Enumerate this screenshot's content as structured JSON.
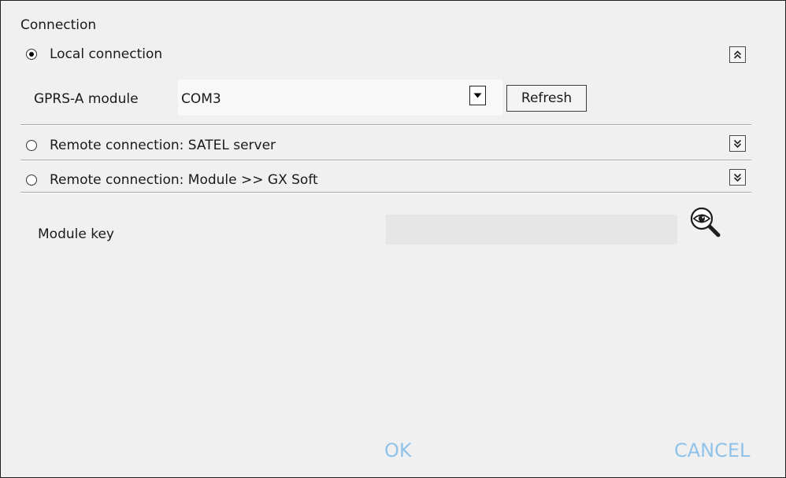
{
  "section_title": "Connection",
  "local": {
    "label": "Local connection",
    "selected": true,
    "module_label": "GPRS-A module",
    "port_value": "COM3",
    "refresh_label": "Refresh"
  },
  "remote_satel": {
    "label": "Remote connection: SATEL server",
    "selected": false
  },
  "remote_module": {
    "label": "Remote connection: Module >> GX Soft",
    "selected": false
  },
  "module_key": {
    "label": "Module key",
    "value": ""
  },
  "footer": {
    "ok_label": "OK",
    "cancel_label": "CANCEL",
    "button_color": "#8fc3ea"
  }
}
